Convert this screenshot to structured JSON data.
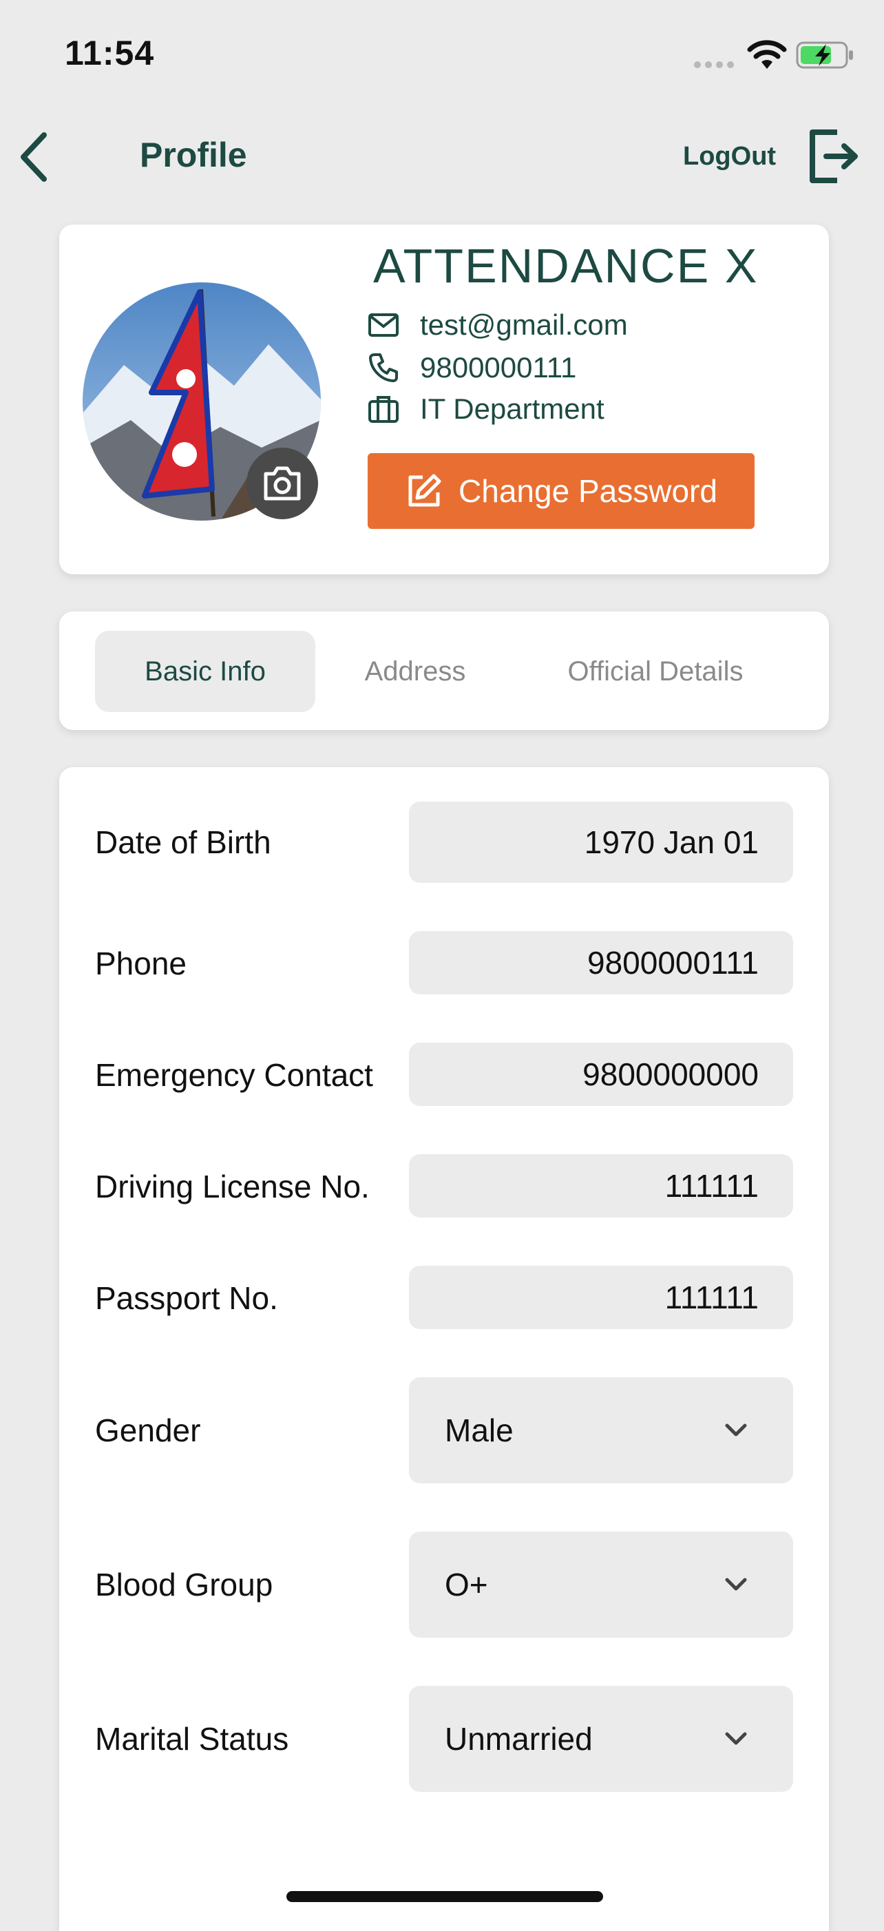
{
  "status": {
    "time": "11:54"
  },
  "header": {
    "title": "Profile",
    "logout_label": "LogOut"
  },
  "profile": {
    "brand": "ATTENDANCE X",
    "email": "test@gmail.com",
    "phone": "9800000111",
    "department": "IT Department",
    "change_password_label": "Change Password"
  },
  "tabs": [
    {
      "label": "Basic Info"
    },
    {
      "label": "Address"
    },
    {
      "label": "Official Details"
    }
  ],
  "form": {
    "dob": {
      "label": "Date of Birth",
      "value": "1970 Jan 01"
    },
    "phone": {
      "label": "Phone",
      "value": "9800000111"
    },
    "emergency": {
      "label": "Emergency Contact",
      "value": "9800000000"
    },
    "license": {
      "label": "Driving License No.",
      "value": "111111"
    },
    "passport": {
      "label": "Passport No.",
      "value": "111111"
    },
    "gender": {
      "label": "Gender",
      "value": "Male"
    },
    "blood": {
      "label": "Blood Group",
      "value": "O+"
    },
    "marital": {
      "label": "Marital Status",
      "value": "Unmarried"
    }
  },
  "colors": {
    "brand_green": "#1d4a42",
    "accent_orange": "#e86f31",
    "background": "#ebebeb"
  }
}
